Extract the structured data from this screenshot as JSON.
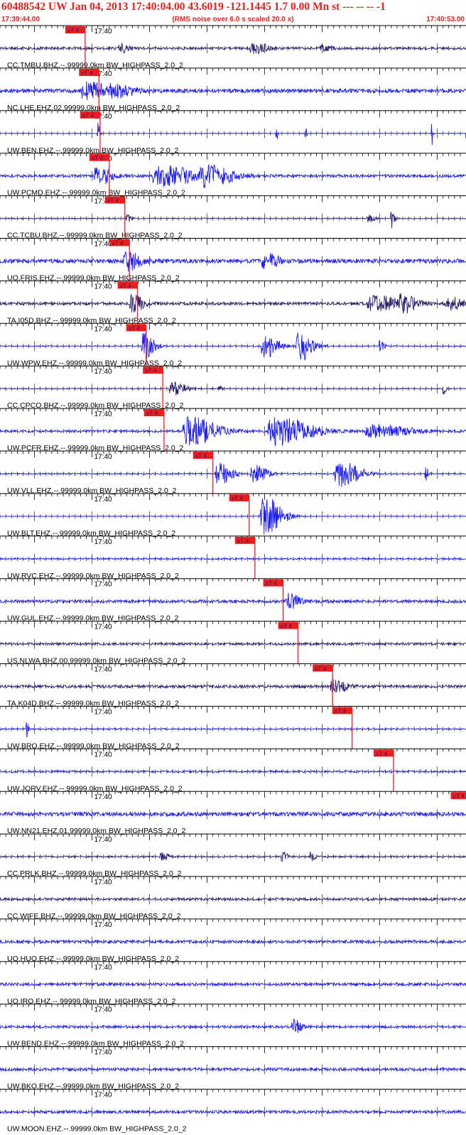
{
  "header": {
    "title": "60488542 UW Jan 04, 2013 17:40:04.00   43.6019 -121.1445  1.7 0.00 Mn st --- -- --  -1",
    "start_time": "17:39:44.00",
    "noise_note": "(RMS noise over 6.0 s scaled 20.0 x)",
    "end_time": "17:40:53.00"
  },
  "colors": {
    "header_text": "#e8201c",
    "trace_blue": "#1a1aff",
    "trace_purple": "#2a1a6e",
    "pick": "#ee1c1c",
    "grid": "#000000"
  },
  "chart_data": {
    "type": "line",
    "title": "60488542 UW Jan 04, 2013 17:40:04.00   43.6019 -121.1445  1.7 0.00 Mn st --- -- --  -1",
    "x_range": [
      "17:39:44.00",
      "17:40:53.00"
    ],
    "minute_tick_label": "17:40",
    "pick_label": "xT 4",
    "series": [
      {
        "name": "CC.TMBU.BHZ.--.99999.0km BW_HIGHPASS_2.0_2",
        "color": "purple",
        "pick_time_s": 14.8,
        "amp": 0.18,
        "bursts": [
          {
            "t": 21,
            "a": 0.7,
            "w": 1.2
          },
          {
            "t": 44,
            "a": 0.9,
            "w": 2
          },
          {
            "t": 56,
            "a": 0.4,
            "w": 1.5
          }
        ]
      },
      {
        "name": "NC.LHE.EHZ.02.99999.0km BW_HIGHPASS_2.0_2",
        "color": "blue",
        "pick_time_s": 17.2,
        "amp": 0.3,
        "bursts": [
          {
            "t": 15,
            "a": 1.4,
            "w": 3
          },
          {
            "t": 20,
            "a": 0.8,
            "w": 3
          }
        ]
      },
      {
        "name": "UW.BEN.EHZ.--.99999.0km BW_HIGHPASS_2.0_2",
        "color": "blue",
        "pick_time_s": 17.4,
        "amp": 0.05,
        "bursts": [
          {
            "t": 17,
            "a": 2.2,
            "w": 0.3
          },
          {
            "t": 48,
            "a": 2.0,
            "w": 0.2
          },
          {
            "t": 53,
            "a": 2.2,
            "w": 0.2
          },
          {
            "t": 75,
            "a": 2.2,
            "w": 0.2
          },
          {
            "t": 81,
            "a": 2.0,
            "w": 0.2
          }
        ]
      },
      {
        "name": "UW.PCMD.EHZ.--.99999.0km BW_HIGHPASS_2.0_2",
        "color": "blue",
        "pick_time_s": 19.0,
        "amp": 0.2,
        "bursts": [
          {
            "t": 17,
            "a": 1.6,
            "w": 2
          },
          {
            "t": 28,
            "a": 1.6,
            "w": 5
          },
          {
            "t": 36,
            "a": 1.4,
            "w": 4
          }
        ]
      },
      {
        "name": "CC.TCBU.BHZ.--.99999.0km BW_HIGHPASS_2.0_2",
        "color": "purple",
        "pick_time_s": 21.7,
        "amp": 0.08,
        "bursts": [
          {
            "t": 22,
            "a": 0.8,
            "w": 0.6
          },
          {
            "t": 64,
            "a": 0.6,
            "w": 1
          },
          {
            "t": 68,
            "a": 1.6,
            "w": 0.5
          }
        ]
      },
      {
        "name": "UO.FRIS.EHZ.--.99999.0km BW_HIGHPASS_2.0_2",
        "color": "blue",
        "pick_time_s": 22.5,
        "amp": 0.32,
        "bursts": [
          {
            "t": 22,
            "a": 1.4,
            "w": 2
          },
          {
            "t": 46,
            "a": 1.2,
            "w": 2
          }
        ]
      },
      {
        "name": "TA.I05D.BHZ.--.99999.0km BW_HIGHPASS_2.0_2",
        "color": "purple",
        "pick_time_s": 23.9,
        "amp": 0.22,
        "bursts": [
          {
            "t": 23,
            "a": 1.5,
            "w": 1.5
          },
          {
            "t": 65,
            "a": 1.2,
            "w": 4
          },
          {
            "t": 70,
            "a": 1.2,
            "w": 2
          },
          {
            "t": 78,
            "a": 1.0,
            "w": 2
          }
        ]
      },
      {
        "name": "UW.WPW.EHZ.--.99999.0km BW_HIGHPASS_2.0_2",
        "color": "blue",
        "pick_time_s": 25.4,
        "amp": 0.08,
        "bursts": [
          {
            "t": 25,
            "a": 2.2,
            "w": 1.5
          },
          {
            "t": 46,
            "a": 2.0,
            "w": 2
          },
          {
            "t": 52,
            "a": 2.4,
            "w": 2
          },
          {
            "t": 66,
            "a": 1.0,
            "w": 0.6
          }
        ]
      },
      {
        "name": "CC.CPCO.BHZ.--.99999.0km BW_HIGHPASS_2.0_2",
        "color": "purple",
        "pick_time_s": 28.3,
        "amp": 0.07,
        "bursts": [
          {
            "t": 30,
            "a": 1.1,
            "w": 2
          },
          {
            "t": 38,
            "a": 0.5,
            "w": 0.5
          },
          {
            "t": 77,
            "a": 1.0,
            "w": 0.4
          }
        ]
      },
      {
        "name": "UW.PCFR.EHZ.--.99999.0km BW_HIGHPASS_2.0_2",
        "color": "blue",
        "pick_time_s": 28.5,
        "amp": 0.18,
        "bursts": [
          {
            "t": 33,
            "a": 2.2,
            "w": 4
          },
          {
            "t": 48,
            "a": 2.2,
            "w": 5
          },
          {
            "t": 65,
            "a": 1.0,
            "w": 5
          }
        ]
      },
      {
        "name": "UW.VLL.EHZ.--.99999.0km BW_HIGHPASS_2.0_2",
        "color": "blue",
        "pick_time_s": 37.0,
        "amp": 0.1,
        "bursts": [
          {
            "t": 38,
            "a": 1.8,
            "w": 2
          },
          {
            "t": 44,
            "a": 1.4,
            "w": 2
          },
          {
            "t": 59,
            "a": 2.0,
            "w": 3
          },
          {
            "t": 74,
            "a": 1.2,
            "w": 0.4
          }
        ]
      },
      {
        "name": "UW.BLT.EHZ.--.99999.0km BW_HIGHPASS_2.0_2",
        "color": "blue",
        "pick_time_s": 43.3,
        "amp": 0.05,
        "bursts": [
          {
            "t": 46,
            "a": 3.2,
            "w": 2.6
          }
        ]
      },
      {
        "name": "UW.RVC.EHZ.--.99999.0km BW_HIGHPASS_2.0_2",
        "color": "blue",
        "pick_time_s": 44.3,
        "amp": 0.12,
        "bursts": []
      },
      {
        "name": "UW.GUL.EHZ.--.99999.0km BW_HIGHPASS_2.0_2",
        "color": "blue",
        "pick_time_s": 49.2,
        "amp": 0.22,
        "bursts": [
          {
            "t": 50,
            "a": 1.4,
            "w": 1.6
          }
        ]
      },
      {
        "name": "US.NLWA.BHZ.00.99999.0km BW_HIGHPASS_2.0_2",
        "color": "purple",
        "pick_time_s": 51.8,
        "amp": 0.18,
        "bursts": []
      },
      {
        "name": "TA.K04D.BHZ.--.99999.0km BW_HIGHPASS_2.0_2",
        "color": "purple",
        "pick_time_s": 57.8,
        "amp": 0.22,
        "bursts": [
          {
            "t": 58,
            "a": 1.0,
            "w": 2
          }
        ]
      },
      {
        "name": "UW.BRO.EHZ.--.99999.0km BW_HIGHPASS_2.0_2",
        "color": "blue",
        "pick_time_s": 61.2,
        "amp": 0.1,
        "bursts": [
          {
            "t": 4.5,
            "a": 1.6,
            "w": 0.3
          }
        ]
      },
      {
        "name": "UW.JORV.EHZ.--.99999.0km BW_HIGHPASS_2.0_2",
        "color": "blue",
        "pick_time_s": 68.4,
        "amp": 0.15,
        "bursts": []
      },
      {
        "name": "UW.NN21.EHZ.01.99999.0km BW_HIGHPASS_2.0_2",
        "color": "blue",
        "pick_time_s": 81.8,
        "amp": 0.32,
        "bursts": [
          {
            "t": 82,
            "a": 1.4,
            "w": 1
          }
        ]
      },
      {
        "name": "CC.PRLK.BHZ.--.99999.0km BW_HIGHPASS_2.0_2",
        "color": "purple",
        "pick_time_s": null,
        "amp": 0.12,
        "bursts": [
          {
            "t": 28,
            "a": 0.8,
            "w": 1
          },
          {
            "t": 49,
            "a": 0.8,
            "w": 0.8
          },
          {
            "t": 54,
            "a": 0.7,
            "w": 0.6
          }
        ]
      },
      {
        "name": "CC.WIFE.BHZ.--.99999.0km BW_HIGHPASS_2.0_2",
        "color": "purple",
        "pick_time_s": null,
        "amp": 0.18,
        "bursts": []
      },
      {
        "name": "UO.HUO.EHZ.--.99999.0km BW_HIGHPASS_2.0_2",
        "color": "blue",
        "pick_time_s": null,
        "amp": 0.22,
        "bursts": []
      },
      {
        "name": "UO.IRO.EHZ.--.99999.0km BW_HIGHPASS_2.0_2",
        "color": "blue",
        "pick_time_s": null,
        "amp": 0.22,
        "bursts": []
      },
      {
        "name": "UW.BEND.EHZ.--.99999.0km BW_HIGHPASS_2.0_2",
        "color": "blue",
        "pick_time_s": null,
        "amp": 0.18,
        "bursts": [
          {
            "t": 51,
            "a": 1.2,
            "w": 1
          }
        ]
      },
      {
        "name": "UW.BKO.EHZ.--.99999.0km BW_HIGHPASS_2.0_2",
        "color": "blue",
        "pick_time_s": null,
        "amp": 0.22,
        "bursts": []
      },
      {
        "name": "UW.MOON.EHZ.--.99999.0km BW_HIGHPASS_2.0_2",
        "color": "blue",
        "pick_time_s": null,
        "amp": 0.22,
        "bursts": []
      }
    ]
  }
}
